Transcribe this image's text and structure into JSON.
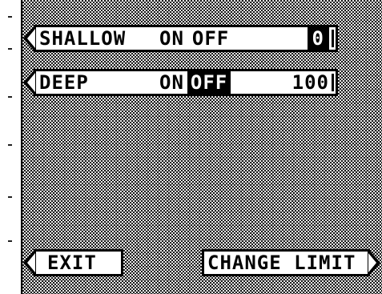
{
  "menu": {
    "shallow": {
      "name": "SHALLOW",
      "on_label": "ON",
      "off_label": "OFF",
      "selected": "none",
      "value": "0"
    },
    "deep": {
      "name": "DEEP",
      "on_label": "ON",
      "off_label": "OFF",
      "selected": "OFF",
      "value": "100"
    }
  },
  "footer": {
    "exit_label": "EXIT",
    "change_limit_label": "CHANGE LIMIT"
  },
  "colors": {
    "highlight_bg": "#000000",
    "highlight_fg": "#ffffff",
    "bar_bg": "#ffffff",
    "screen_dither_dark": "#1a1a1a",
    "screen_dither_light": "#e8e8e8"
  }
}
